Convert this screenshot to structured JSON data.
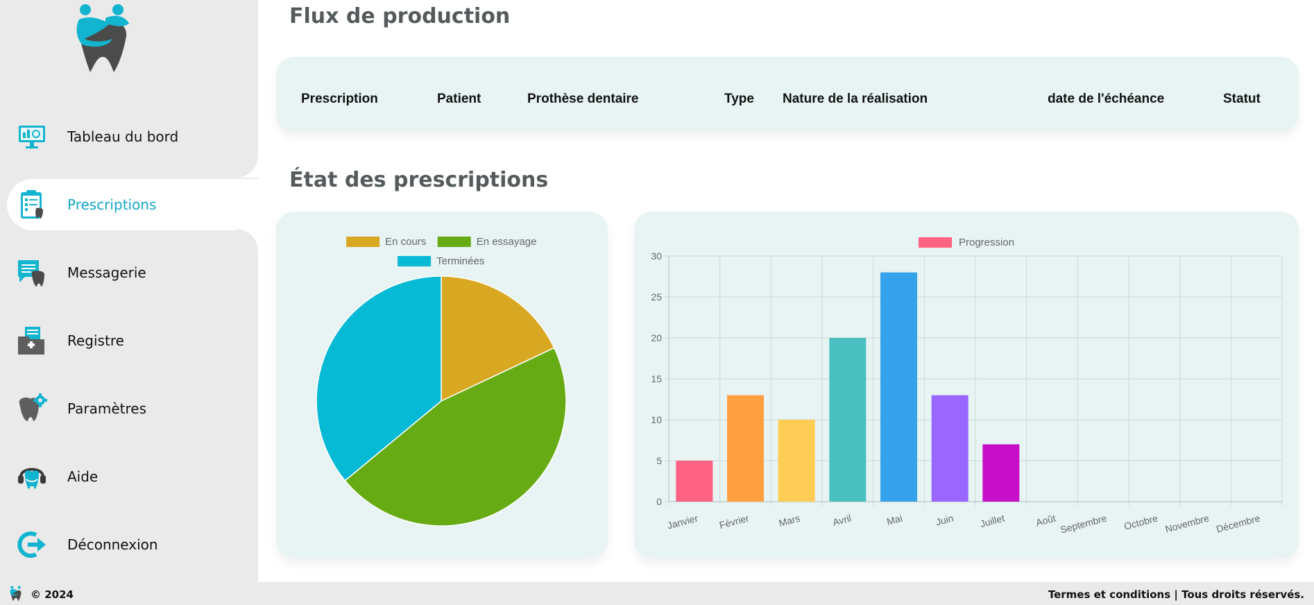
{
  "sidebar": {
    "logo_icon": "dental-family-logo-icon",
    "items": [
      {
        "label": "Tableau du bord",
        "icon": "dashboard-monitor-icon",
        "active": false
      },
      {
        "label": "Prescriptions",
        "icon": "prescription-clipboard-icon",
        "active": true
      },
      {
        "label": "Messagerie",
        "icon": "message-tooth-icon",
        "active": false
      },
      {
        "label": "Registre",
        "icon": "medical-register-icon",
        "active": false
      },
      {
        "label": "Paramètres",
        "icon": "tooth-gear-icon",
        "active": false
      },
      {
        "label": "Aide",
        "icon": "headset-tooth-icon",
        "active": false
      },
      {
        "label": "Déconnexion",
        "icon": "logout-icon",
        "active": false
      }
    ]
  },
  "main": {
    "production_title": "Flux de production",
    "table": {
      "columns": [
        "Prescription",
        "Patient",
        "Prothèse dentaire",
        "Type",
        "Nature de la réalisation",
        "date de l'échéance",
        "Statut"
      ]
    },
    "status_title": "État des prescriptions"
  },
  "chart_data": [
    {
      "type": "pie",
      "labels": [
        "En cours",
        "En essayage",
        "Terminées"
      ],
      "values": [
        18,
        46,
        36
      ],
      "colors": [
        "#d8a822",
        "#66ab14",
        "#06b9d4"
      ],
      "legend": "top"
    },
    {
      "type": "bar",
      "categories": [
        "Janvier",
        "Février",
        "Mars",
        "Avril",
        "Mai",
        "Juin",
        "Juillet",
        "Août",
        "Septembre",
        "Octobre",
        "Novembre",
        "Décembre"
      ],
      "series": [
        {
          "name": "Progression",
          "values": [
            5,
            13,
            10,
            20,
            28,
            13,
            7,
            0,
            0,
            0,
            0,
            0
          ]
        }
      ],
      "bar_colors": [
        "#ff6384",
        "#ff9f40",
        "#ffcd56",
        "#4bc0c0",
        "#36a2eb",
        "#9966ff",
        "#c80fc8"
      ],
      "legend_color": "#ff6384",
      "ylim": [
        0,
        30
      ],
      "yticks": [
        0,
        5,
        10,
        15,
        20,
        25,
        30
      ],
      "grid": true,
      "legend": "top"
    }
  ],
  "footer": {
    "copyright": "© 2024",
    "terms": "Termes et conditions | Tous droits réservés."
  }
}
